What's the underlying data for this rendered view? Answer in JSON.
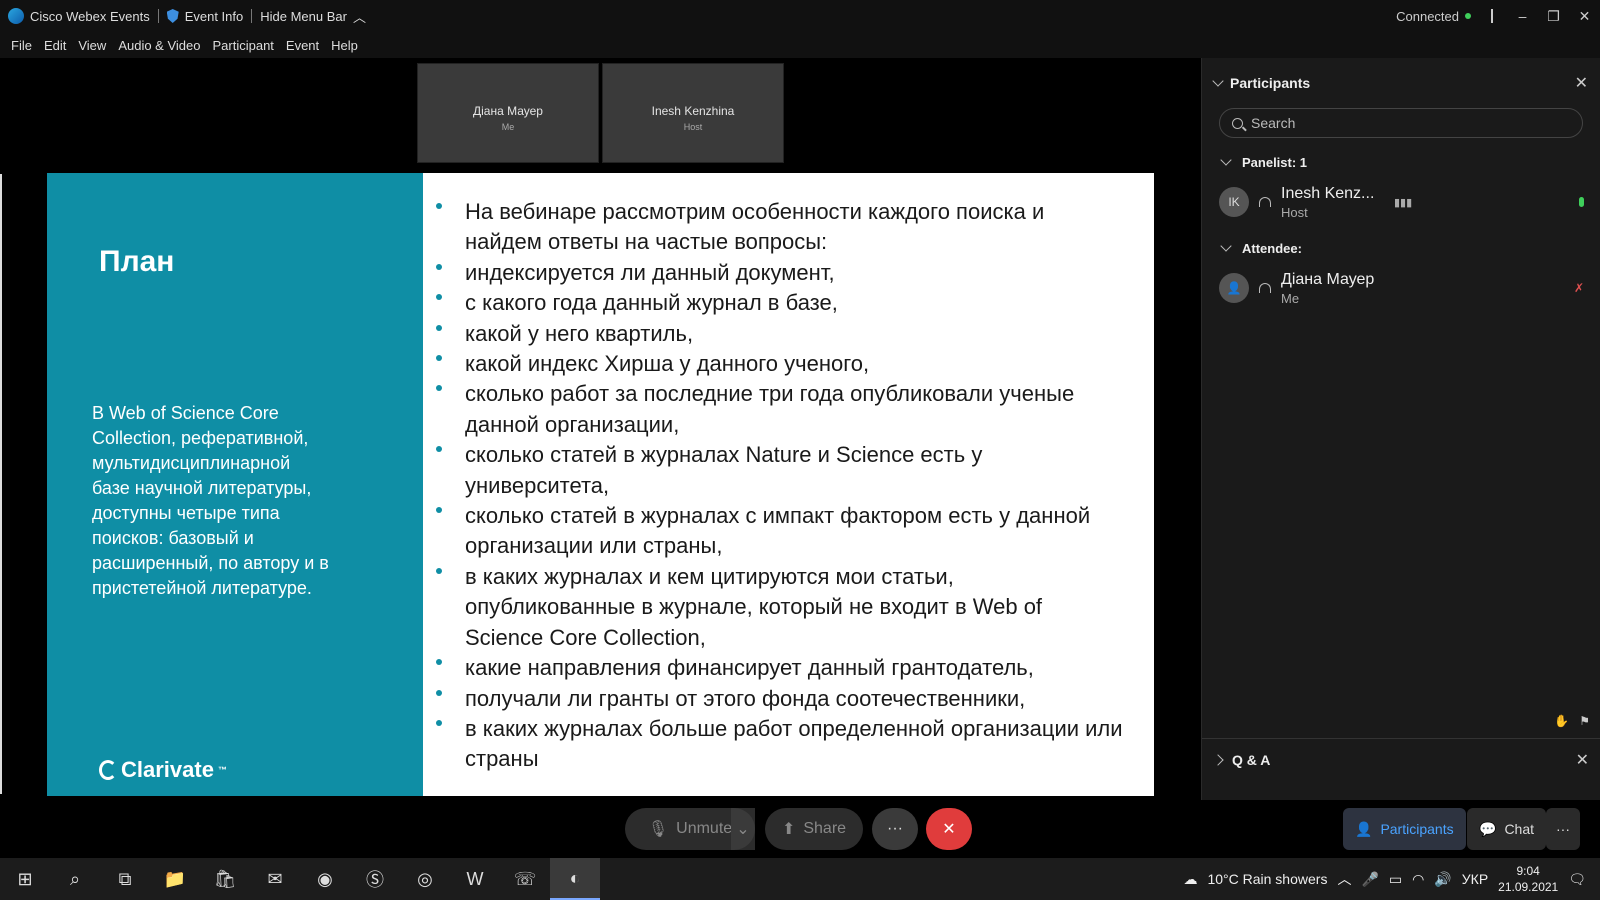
{
  "titlebar": {
    "app_name": "Cisco Webex Events",
    "event_info": "Event Info",
    "hide_menu": "Hide Menu Bar",
    "status": "Connected"
  },
  "menu": [
    "File",
    "Edit",
    "View",
    "Audio & Video",
    "Participant",
    "Event",
    "Help"
  ],
  "thumbnails": [
    {
      "name": "Діана Мауер",
      "role": "Me"
    },
    {
      "name": "Inesh Kenzhina",
      "role": "Host"
    }
  ],
  "slide": {
    "title": "План",
    "description": "В Web of Science Core Collection, реферативной, мультидисциплинарной базе научной литературы, доступны четыре типа поисков: базовый и расширенный, по автору и в пристетейной литературе.",
    "brand": "Clarivate",
    "bullets": [
      "На вебинаре рассмотрим особенности каждого поиска и найдем ответы на частые вопросы:",
      " индексируется ли данный документ,",
      "с какого года данный журнал в базе,",
      "какой у него квартиль,",
      "какой индекс Хирша у данного ученого,",
      "сколько работ за последние три года опубликовали ученые данной организации,",
      "сколько статей в журналах Nature и Science есть у университета,",
      "сколько статей в журналах с импакт фактором есть у данной организации или страны,",
      "в каких журналах и кем цитируются мои статьи, опубликованные в журнале, который не входит в Web of Science Core Collection,",
      "какие направления финансирует данный грантодатель,",
      "получали ли гранты от этого фонда соотечественники,",
      "в каких журналах больше работ определенной организации или страны"
    ]
  },
  "panel": {
    "title": "Participants",
    "search_placeholder": "Search",
    "panelist_label": "Panelist: 1",
    "attendee_label": "Attendee:",
    "panelist": {
      "initials": "IK",
      "name": "Inesh Kenz...",
      "role": "Host"
    },
    "attendee": {
      "name": "Діана Мауер",
      "role": "Me"
    },
    "qa_label": "Q & A"
  },
  "controls": {
    "unmute": "Unmute",
    "share": "Share",
    "more": "···",
    "participants": "Participants",
    "chat": "Chat"
  },
  "taskbar": {
    "weather": "10°C  Rain showers",
    "lang": "УКР",
    "time": "9:04",
    "date": "21.09.2021"
  },
  "colors": {
    "slide_accent": "#0f8ea5",
    "leave_red": "#e03c3c",
    "active_blue": "#4aa3ff"
  }
}
